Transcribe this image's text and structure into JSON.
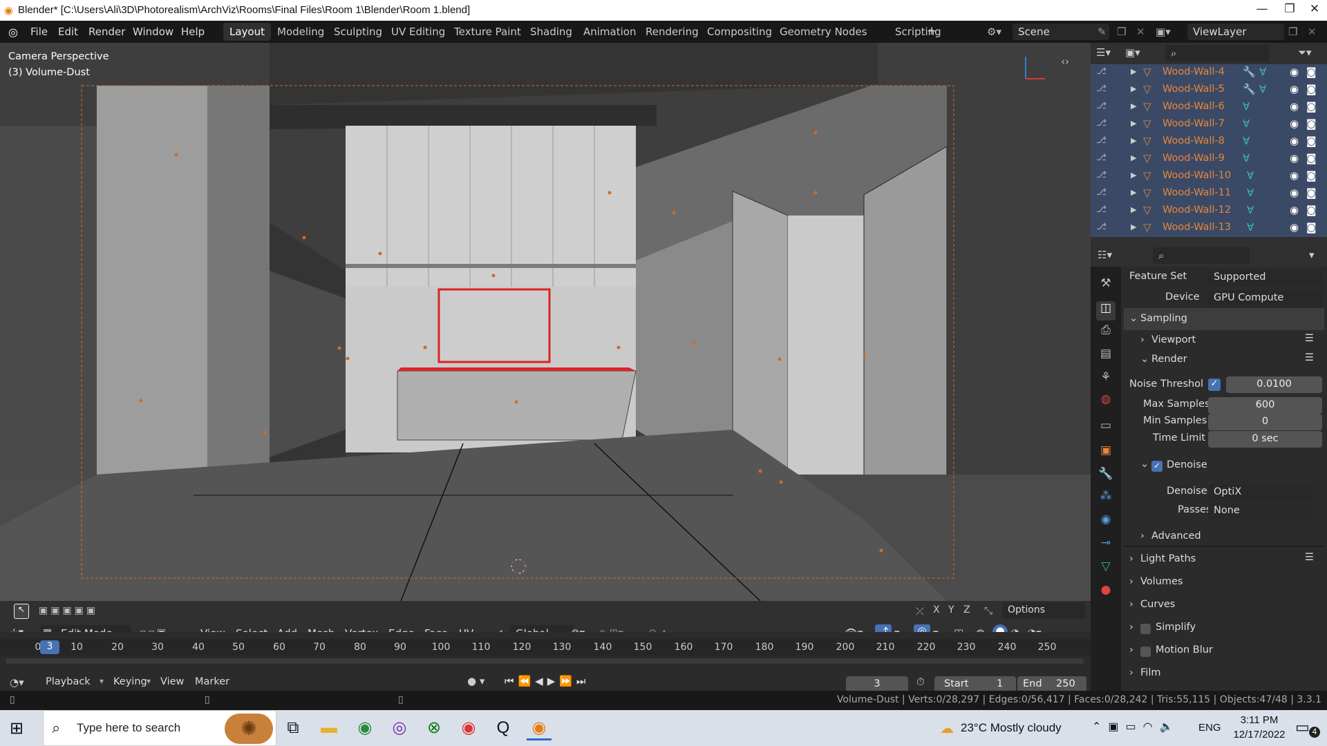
{
  "title": "Blender* [C:\\Users\\Ali\\3D\\Photorealism\\ArchViz\\Rooms\\Final Files\\Room 1\\Blender\\Room 1.blend]",
  "window_controls": [
    "—",
    "❐",
    "✕"
  ],
  "menu": [
    "File",
    "Edit",
    "Render",
    "Window",
    "Help"
  ],
  "workspaces": [
    "Layout",
    "Modeling",
    "Sculpting",
    "UV Editing",
    "Texture Paint",
    "Shading",
    "Animation",
    "Rendering",
    "Compositing",
    "Geometry Nodes",
    "Scripting",
    "+"
  ],
  "scene": "Scene",
  "view_layer": "ViewLayer",
  "viewport": {
    "overlay_line1": "Camera Perspective",
    "overlay_line2": "(3) Volume-Dust"
  },
  "header3d": {
    "mode": "Edit Mode",
    "menus": [
      "View",
      "Select",
      "Add",
      "Mesh",
      "Vertex",
      "Edge",
      "Face",
      "UV"
    ],
    "orientation": "Global",
    "options": "Options",
    "axes": [
      "X",
      "Y",
      "Z"
    ]
  },
  "outliner": {
    "items": [
      "Wood-Wall-4",
      "Wood-Wall-5",
      "Wood-Wall-6",
      "Wood-Wall-7",
      "Wood-Wall-8",
      "Wood-Wall-9",
      "Wood-Wall-10",
      "Wood-Wall-11",
      "Wood-Wall-12",
      "Wood-Wall-13"
    ]
  },
  "props": {
    "feature_set_label": "Feature Set",
    "feature_set": "Supported",
    "device_label": "Device",
    "device": "GPU Compute",
    "sampling": "Sampling",
    "viewport": "Viewport",
    "render": "Render",
    "noise_label": "Noise Threshol",
    "noise_value": "0.0100",
    "max_label": "Max Samples",
    "max_value": "600",
    "min_label": "Min Samples",
    "min_value": "0",
    "time_label": "Time Limit",
    "time_value": "0 sec",
    "denoise": "Denoise",
    "denoiser_label": "Denoiser",
    "denoiser": "OptiX",
    "passes_label": "Passes",
    "passes": "None",
    "advanced": "Advanced",
    "light_paths": "Light Paths",
    "volumes": "Volumes",
    "curves": "Curves",
    "simplify": "Simplify",
    "motion_blur": "Motion Blur",
    "film": "Film"
  },
  "timeline": {
    "ticks": [
      "0",
      "10",
      "20",
      "30",
      "40",
      "50",
      "60",
      "70",
      "80",
      "90",
      "100",
      "110",
      "120",
      "130",
      "140",
      "150",
      "160",
      "170",
      "180",
      "190",
      "200",
      "210",
      "220",
      "230",
      "240",
      "250"
    ],
    "current_frame": "3",
    "playback": "Playback",
    "keying": "Keying",
    "view": "View",
    "marker": "Marker",
    "frame_field": "3",
    "start_label": "Start",
    "start": "1",
    "end_label": "End",
    "end": "250"
  },
  "status": "Volume-Dust | Verts:0/28,297 | Edges:0/56,417 | Faces:0/28,242 | Tris:55,115 | Objects:47/48 | 3.3.1",
  "taskbar": {
    "search": "Type here to search",
    "weather": "23°C  Mostly cloudy",
    "lang": "ENG",
    "time": "3:11 PM",
    "date": "12/17/2022",
    "notif": "4"
  }
}
